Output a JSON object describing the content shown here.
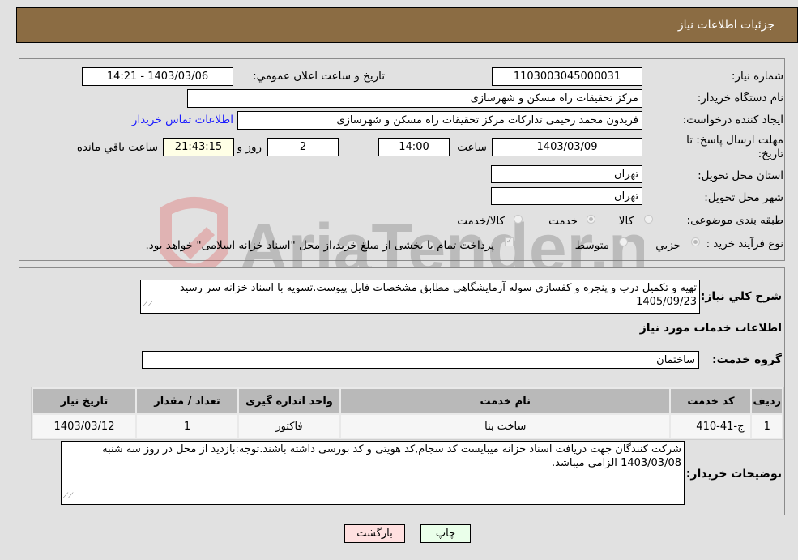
{
  "header": {
    "title": "جزئیات اطلاعات نیاز"
  },
  "form": {
    "need_number": {
      "label": "شماره نیاز:",
      "value": "1103003045000031"
    },
    "announce_datetime": {
      "label": "تاریخ و ساعت اعلان عمومي:",
      "value": "1403/03/06 - 14:21"
    },
    "buyer_org": {
      "label": "نام دستگاه خریدار:",
      "value": "مرکز تحقیقات راه  مسکن و شهرسازی"
    },
    "requester": {
      "label": "ایجاد کننده درخواست:",
      "value": "فریدون محمد رحیمی تدارکات مرکز تحقیقات راه  مسکن و شهرسازی"
    },
    "buyer_contact_link": "اطلاعات تماس خریدار",
    "deadline": {
      "label": "مهلت ارسال پاسخ: تا تاریخ:",
      "date": "1403/03/09",
      "time_label": "ساعت",
      "time": "14:00",
      "days": "2",
      "days_label": "روز و",
      "remaining": "21:43:15",
      "remaining_label": "ساعت باقي مانده"
    },
    "province": {
      "label": "استان محل تحویل:",
      "value": "تهران"
    },
    "city": {
      "label": "شهر محل تحویل:",
      "value": "تهران"
    },
    "category": {
      "label": "طبقه بندی موضوعی:",
      "options": [
        "کالا",
        "خدمت",
        "کالا/خدمت"
      ],
      "selected": "خدمت"
    },
    "purchase_type": {
      "label": "نوع فرآیند خرید :",
      "options": [
        "جزيي",
        "متوسط"
      ],
      "selected": "جزيي",
      "treasury_note": "پرداخت تمام یا بخشی از مبلغ خرید،از محل \"اسناد خزانه اسلامی\" خواهد بود."
    }
  },
  "description": {
    "label": "شرح کلي نیاز:",
    "value": "تهیه و تکمیل درب و پنجره و کفسازی سوله آزمایشگاهی مطابق مشخصات فایل پیوست.تسویه با اسناد خزانه سر رسید 1405/09/23"
  },
  "services": {
    "section_title": "اطلاعات خدمات مورد نیاز",
    "group_label": "گروه خدمت:",
    "group_value": "ساختمان",
    "columns": [
      "ردیف",
      "کد خدمت",
      "نام خدمت",
      "واحد اندازه گیری",
      "تعداد / مقدار",
      "تاریخ نیاز"
    ],
    "rows": [
      [
        "1",
        "ج-41-410",
        "ساخت بنا",
        "فاکتور",
        "1",
        "1403/03/12"
      ]
    ]
  },
  "buyer_notes": {
    "label": "توضیحات خریدار:",
    "value": "شرکت کنندگان جهت دریافت اسناد خزانه میبایست کد سجام,کد هویتی و کد بورسی داشته باشند.توجه:بازدید از محل در روز سه شنبه 1403/03/08 الزامی میباشد."
  },
  "buttons": {
    "print": "چاپ",
    "back": "بازگشت"
  },
  "colors": {
    "header_bg": "#8b6c43",
    "print_bg": "#eaffea",
    "back_bg": "#ffe0e0",
    "remaining_bg": "#ffffe6",
    "link": "#1a1aff"
  },
  "watermark": {
    "text": "AriaTender.neT"
  }
}
